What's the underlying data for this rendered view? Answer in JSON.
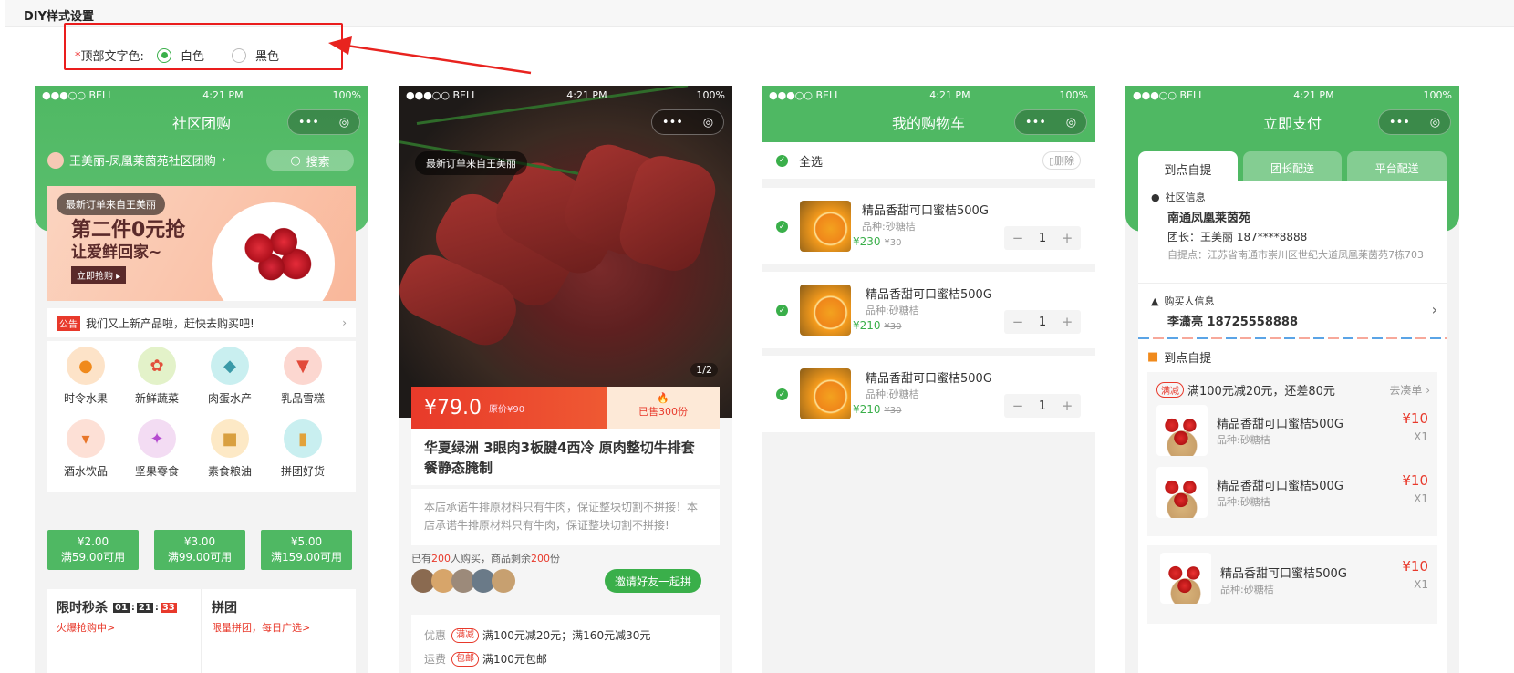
{
  "header": {
    "title": "DIY样式设置"
  },
  "option": {
    "required_mark": "*",
    "label": "顶部文字色:",
    "choices": [
      {
        "label": "白色",
        "selected": true
      },
      {
        "label": "黑色",
        "selected": false
      }
    ],
    "accent_color": "#3aaf4a"
  },
  "status_bar": {
    "carrier": "●●●○○ BELL",
    "time": "4:21 PM",
    "battery": "100%"
  },
  "capsule": {
    "more": "•••",
    "close": "◎"
  },
  "phone1": {
    "nav_title": "社区团购",
    "store": "王美丽-凤凰莱茵苑社区团购",
    "search_placeholder": "搜索",
    "banner_notice": "最新订单来自王美丽",
    "banner_line1": "第二件0元抢",
    "banner_line2": "让爱鲜回家~",
    "banner_button": "立即抢购 ▸",
    "notice_tag": "公告",
    "notice_text": "我们又上新产品啦，赶快去购买吧!",
    "categories": [
      {
        "label": "时令水果",
        "icon": "orange-icon"
      },
      {
        "label": "新鲜蔬菜",
        "icon": "vegetable-icon"
      },
      {
        "label": "肉蛋水产",
        "icon": "fish-icon"
      },
      {
        "label": "乳品雪糕",
        "icon": "icecream-icon"
      },
      {
        "label": "酒水饮品",
        "icon": "drink-icon"
      },
      {
        "label": "坚果零食",
        "icon": "snack-icon"
      },
      {
        "label": "素食粮油",
        "icon": "oil-icon"
      },
      {
        "label": "拼团好货",
        "icon": "group-goods-icon"
      }
    ],
    "coupons": [
      {
        "amount": "¥2.00",
        "cond": "满59.00可用"
      },
      {
        "amount": "¥3.00",
        "cond": "满99.00可用"
      },
      {
        "amount": "¥5.00",
        "cond": "满159.00可用"
      }
    ],
    "flash_title": "限时秒杀",
    "flash_h": "01",
    "flash_m": "21",
    "flash_s": "33",
    "flash_sub": "火爆抢购中>",
    "group_title": "拼团",
    "group_sub": "限量拼团，每日广选>"
  },
  "phone2": {
    "notice": "最新订单来自王美丽",
    "page": "1/2",
    "price": "¥79.0",
    "orig_price": "原价¥90",
    "sold": "已售300份",
    "title": "华夏绿洲 3眼肉3板腱4西冷 原肉整切牛排套餐静态腌制",
    "desc": "本店承诺牛排原材料只有牛肉，保证整块切割不拼接！本店承诺牛排原材料只有牛肉，保证整块切割不拼接!",
    "bought_prefix": "已有",
    "bought_count": "200",
    "bought_mid": "人购买，商品剩余",
    "remain": "200",
    "bought_suffix": "份",
    "invite": "邀请好友一起拼",
    "promo_label": "优惠",
    "promo_tag": "满减",
    "promo_text": "满100元减20元；满160元减30元",
    "ship_label": "运费",
    "ship_tag": "包邮",
    "ship_text": "满100元包邮"
  },
  "phone3": {
    "nav_title": "我的购物车",
    "select_all": "全选",
    "delete": "删除",
    "items": [
      {
        "name": "精品香甜可口蜜桔500G",
        "spec": "品种:砂糖桔",
        "price": "¥230",
        "orig": "¥30",
        "qty": "1"
      },
      {
        "name": "精品香甜可口蜜桔500G",
        "spec": "品种:砂糖桔",
        "price": "¥210",
        "orig": "¥30",
        "qty": "1"
      },
      {
        "name": "精品香甜可口蜜桔500G",
        "spec": "品种:砂糖桔",
        "price": "¥210",
        "orig": "¥30",
        "qty": "1"
      }
    ]
  },
  "phone4": {
    "nav_title": "立即支付",
    "tabs": [
      "到点自提",
      "团长配送",
      "平台配送"
    ],
    "community_label": "社区信息",
    "community_name": "南通凤凰莱茵苑",
    "leader": "团长：王美丽    187****8888",
    "pickup": "自提点：江苏省南通市崇川区世纪大道凤凰莱茵苑7栋703",
    "buyer_label": "购买人信息",
    "buyer": "李潇亮    18725558888",
    "section_title": "到点自提",
    "promo_tag": "满减",
    "promo_text": "满100元减20元，还差80元",
    "promo_link": "去凑单",
    "items": [
      {
        "name": "精品香甜可口蜜桔500G",
        "spec": "品种:砂糖桔",
        "price": "¥10",
        "qty": "X1"
      },
      {
        "name": "精品香甜可口蜜桔500G",
        "spec": "品种:砂糖桔",
        "price": "¥10",
        "qty": "X1"
      },
      {
        "name": "精品香甜可口蜜桔500G",
        "spec": "品种:砂糖桔",
        "price": "¥10",
        "qty": "X1"
      }
    ]
  }
}
